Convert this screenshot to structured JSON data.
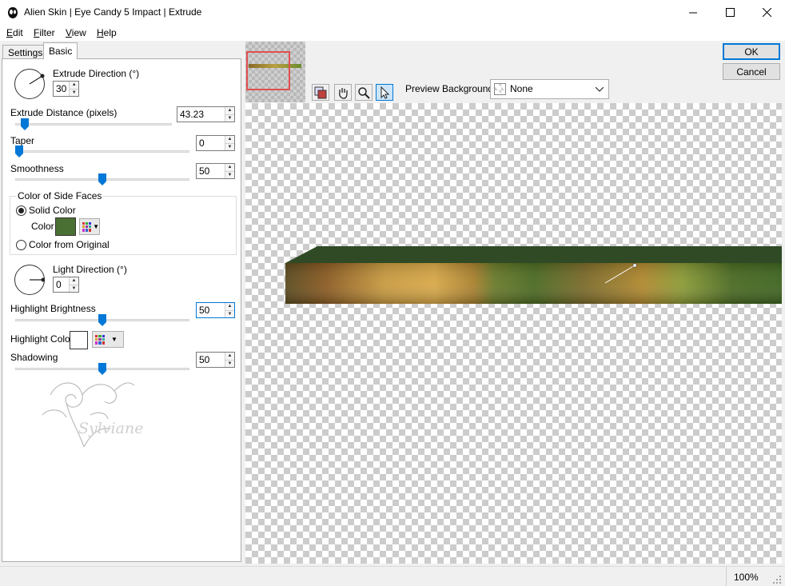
{
  "window": {
    "title": "Alien Skin | Eye Candy 5 Impact | Extrude"
  },
  "menu": {
    "edit": {
      "accel": "E",
      "rest": "dit"
    },
    "filter": {
      "accel": "F",
      "rest": "ilter"
    },
    "view": {
      "accel": "V",
      "rest": "iew"
    },
    "help": {
      "accel": "H",
      "rest": "elp"
    }
  },
  "tabs": {
    "settings": "Settings",
    "basic": "Basic",
    "active": "Basic"
  },
  "basic": {
    "extrude_direction": {
      "label": "Extrude Direction (°)",
      "value": "30"
    },
    "extrude_distance": {
      "label": "Extrude Distance (pixels)",
      "value": "43.23",
      "slider_fraction": 0.07
    },
    "taper": {
      "label": "Taper",
      "value": "0",
      "slider_fraction": 0.0
    },
    "smoothness": {
      "label": "Smoothness",
      "value": "50",
      "slider_fraction": 0.5
    },
    "color_side_faces": {
      "label": "Color of Side Faces",
      "solid_color_label": "Solid Color",
      "color_label": "Color",
      "color_from_original_label": "Color from Original",
      "selected": "Solid Color",
      "swatch_color": "#4a7033"
    },
    "light_direction": {
      "label": "Light Direction (°)",
      "value": "0"
    },
    "highlight_brightness": {
      "label": "Highlight Brightness",
      "value": "50",
      "slider_fraction": 0.5
    },
    "highlight_color": {
      "label": "Highlight Color",
      "swatch_color": "#ffffff"
    },
    "shadowing": {
      "label": "Shadowing",
      "value": "50",
      "slider_fraction": 0.5
    }
  },
  "watermark": {
    "text": "Sylviane"
  },
  "preview": {
    "background_label": "Preview Background:",
    "background_value": "None",
    "tools": [
      "hand-icon",
      "zoom-icon",
      "pointer-icon"
    ]
  },
  "buttons": {
    "ok": "OK",
    "cancel": "Cancel"
  },
  "status": {
    "zoom": "100%"
  },
  "colors": {
    "accent": "#0078d7",
    "slider_thumb": "#0078d7",
    "extrude_top": "#2f4a25"
  }
}
